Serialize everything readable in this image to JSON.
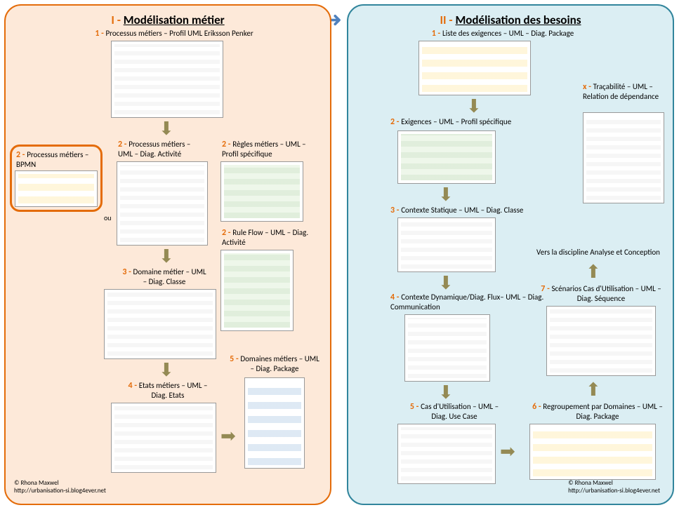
{
  "left": {
    "title_num": "I - ",
    "title_text": "Modélisation métier",
    "s1": {
      "n": "1 - ",
      "t": "Processus métiers – Profil UML Eriksson Penker"
    },
    "s2a": {
      "n": "2 - ",
      "t": "Processus métiers – BPMN"
    },
    "s2b": {
      "n": "2 - ",
      "t": "Processus métiers – UML – Diag. Activité"
    },
    "s2c": {
      "n": "2 - ",
      "t": "Règles métiers – UML – Profil spécifique"
    },
    "s2d": {
      "n": "2 - ",
      "t": "Rule Flow – UML – Diag. Activité"
    },
    "s3": {
      "n": "3 - ",
      "t": "Domaine métier – UML – Diag. Classe"
    },
    "s4": {
      "n": "4 - ",
      "t": "Etats métiers – UML – Diag. Etats"
    },
    "s5": {
      "n": "5 - ",
      "t": "Domaines métiers – UML – Diag. Package"
    },
    "ou": "ou",
    "credit1": "© Rhona Maxwel",
    "credit2": "http://urbanisation-si.blog4ever.net"
  },
  "right": {
    "title_num": "II - ",
    "title_text": "Modélisation des besoins",
    "s1": {
      "n": "1 - ",
      "t": "Liste des exigences – UML – Diag. Package"
    },
    "s2": {
      "n": "2 - ",
      "t": "Exigences – UML – Profil spécifique"
    },
    "s3": {
      "n": "3 - ",
      "t": "Contexte Statique – UML – Diag. Classe"
    },
    "s4": {
      "n": "4 - ",
      "t": "Contexte Dynamique/Diag. Flux– UML – Diag. Communication"
    },
    "s5": {
      "n": "5 - ",
      "t": "Cas d'Utilisation – UML – Diag. Use Case"
    },
    "s6": {
      "n": "6 - ",
      "t": "Regroupement par Domaines – UML – Diag. Package"
    },
    "s7": {
      "n": "7 - ",
      "t": "Scénarios Cas d'Utilisation  – UML – Diag. Séquence"
    },
    "sx": {
      "n": "x - ",
      "t": "Traçabilité – UML – Relation de dépendance"
    },
    "next": "Vers la discipline Analyse et Conception",
    "credit1": "© Rhona Maxwel",
    "credit2": "http://urbanisation-si.blog4ever.net"
  }
}
